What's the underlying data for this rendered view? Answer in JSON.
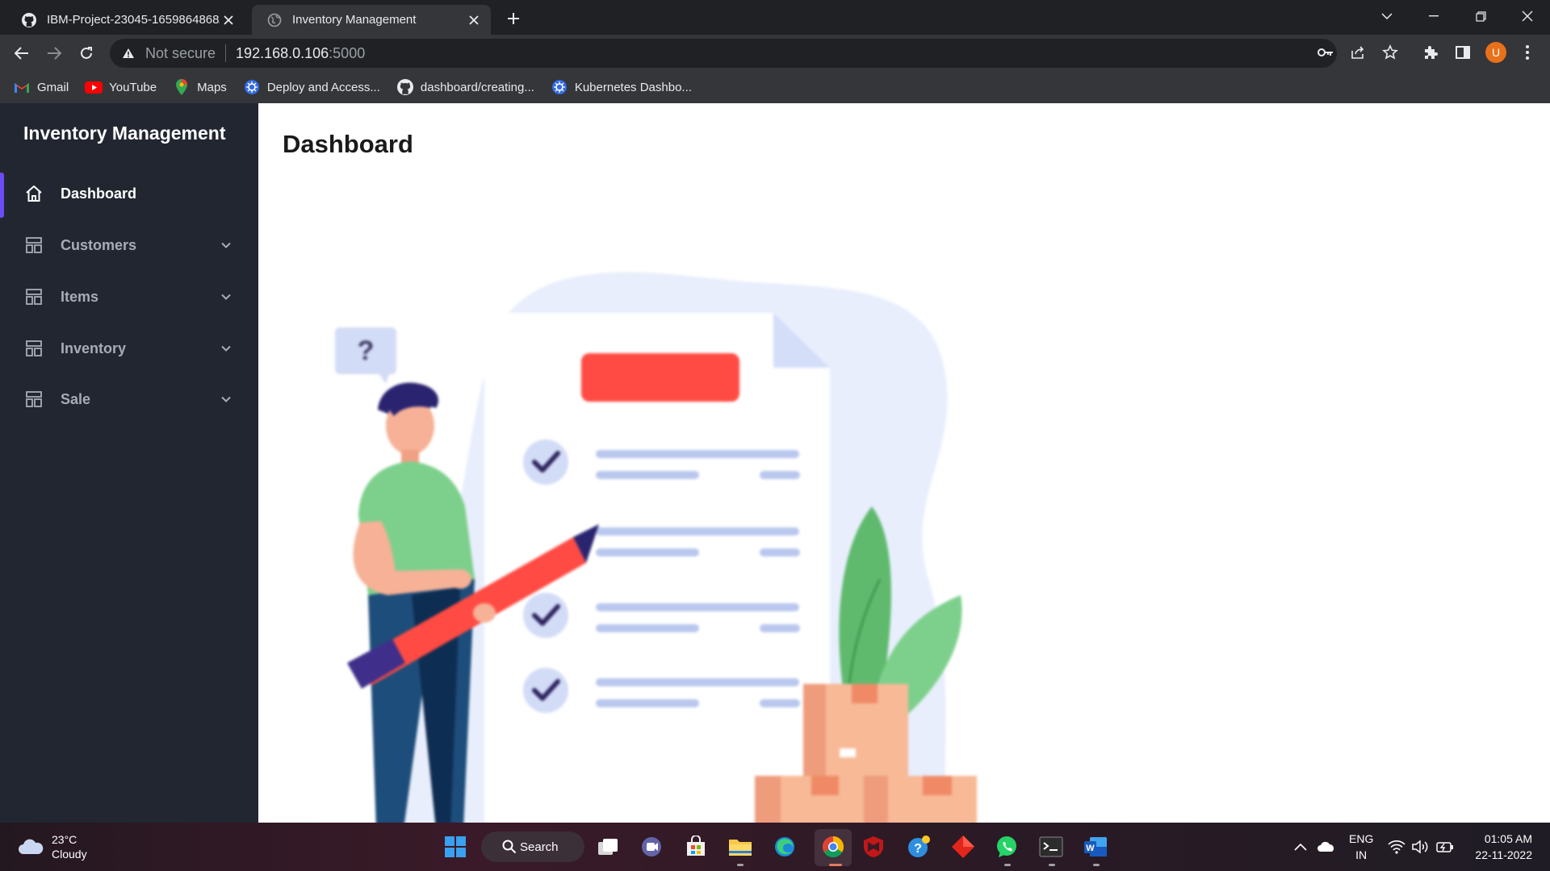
{
  "browser": {
    "tabs": [
      {
        "title": "IBM-Project-23045-1659864868/",
        "favicon": "github-icon",
        "active": false
      },
      {
        "title": "Inventory Management",
        "favicon": "globe-icon",
        "active": true
      }
    ],
    "address": {
      "security_label": "Not secure",
      "host": "192.168.0.106",
      "port": ":5000"
    },
    "profile_initial": "U",
    "bookmarks": [
      {
        "label": "Gmail",
        "icon": "gmail-icon"
      },
      {
        "label": "YouTube",
        "icon": "youtube-icon"
      },
      {
        "label": "Maps",
        "icon": "maps-icon"
      },
      {
        "label": "Deploy and Access...",
        "icon": "kubernetes-icon"
      },
      {
        "label": "dashboard/creating...",
        "icon": "github-icon"
      },
      {
        "label": "Kubernetes Dashbo...",
        "icon": "kubernetes-icon"
      }
    ]
  },
  "app": {
    "brand": "Inventory Management",
    "nav": [
      {
        "label": "Dashboard",
        "icon": "home-icon",
        "active": true,
        "expandable": false
      },
      {
        "label": "Customers",
        "icon": "layout-icon",
        "active": false,
        "expandable": true
      },
      {
        "label": "Items",
        "icon": "layout-icon",
        "active": false,
        "expandable": true
      },
      {
        "label": "Inventory",
        "icon": "layout-icon",
        "active": false,
        "expandable": true
      },
      {
        "label": "Sale",
        "icon": "layout-icon",
        "active": false,
        "expandable": true
      }
    ],
    "page_title": "Dashboard",
    "illustration": "checklist-illustration",
    "colors": {
      "sidebar_bg": "#212631",
      "active_indicator": "#6c4cf4",
      "illustration_red": "#ff4b43",
      "illustration_green": "#7dd08c"
    }
  },
  "taskbar": {
    "weather": {
      "temp": "23°C",
      "condition": "Cloudy"
    },
    "search_label": "Search",
    "language": {
      "line1": "ENG",
      "line2": "IN"
    },
    "clock": {
      "time": "01:05 AM",
      "date": "22-11-2022"
    }
  }
}
